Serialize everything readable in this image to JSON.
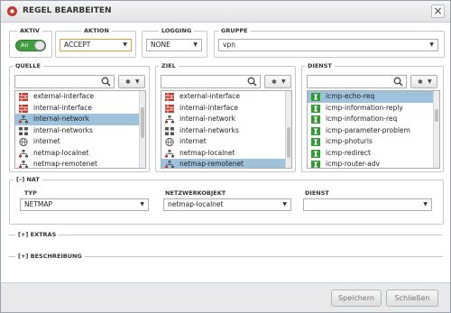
{
  "title": "REGEL BEARBEITEN",
  "close_glyph": "×",
  "aktiv": {
    "label": "AKTIV",
    "toggle_text": "An",
    "on": true
  },
  "aktion": {
    "label": "AKTION",
    "value": "ACCEPT"
  },
  "logging": {
    "label": "LOGGING",
    "value": "NONE"
  },
  "gruppe": {
    "label": "GRUPPE",
    "value": "vpn"
  },
  "quelle": {
    "label": "QUELLE",
    "search_value": "",
    "items": [
      {
        "label": "external-interface",
        "icon": "firewall-interface-icon",
        "selected": false
      },
      {
        "label": "internal-interface",
        "icon": "firewall-interface-icon",
        "selected": false
      },
      {
        "label": "internal-network",
        "icon": "network-icon",
        "selected": true
      },
      {
        "label": "internal-networks",
        "icon": "networks-icon",
        "selected": false
      },
      {
        "label": "internet",
        "icon": "globe-icon",
        "selected": false
      },
      {
        "label": "netmap-localnet",
        "icon": "network-icon",
        "selected": false
      },
      {
        "label": "netmap-remotenet",
        "icon": "network-icon",
        "selected": false
      }
    ]
  },
  "ziel": {
    "label": "ZIEL",
    "search_value": "",
    "items": [
      {
        "label": "external-interface",
        "icon": "firewall-interface-icon",
        "selected": false
      },
      {
        "label": "internal-interface",
        "icon": "firewall-interface-icon",
        "selected": false
      },
      {
        "label": "internal-network",
        "icon": "network-icon",
        "selected": false
      },
      {
        "label": "internal-networks",
        "icon": "networks-icon",
        "selected": false
      },
      {
        "label": "internet",
        "icon": "globe-icon",
        "selected": false
      },
      {
        "label": "netmap-localnet",
        "icon": "network-icon",
        "selected": false
      },
      {
        "label": "netmap-remotenet",
        "icon": "network-icon",
        "selected": true
      }
    ]
  },
  "dienst": {
    "label": "DIENST",
    "search_value": "",
    "items": [
      {
        "label": "icmp-echo-req",
        "icon": "service-icon",
        "selected": true
      },
      {
        "label": "icmp-information-reply",
        "icon": "service-icon",
        "selected": false
      },
      {
        "label": "icmp-information-req",
        "icon": "service-icon",
        "selected": false
      },
      {
        "label": "icmp-parameter-problem",
        "icon": "service-icon",
        "selected": false
      },
      {
        "label": "icmp-photuris",
        "icon": "service-icon",
        "selected": false
      },
      {
        "label": "icmp-redirect",
        "icon": "service-icon",
        "selected": false
      },
      {
        "label": "icmp-router-adv",
        "icon": "service-icon",
        "selected": false
      }
    ]
  },
  "nat": {
    "label": "[–] NAT",
    "typ_label": "TYP",
    "typ_value": "NETMAP",
    "netzwerkobjekt_label": "NETZWERKOBJEKT",
    "netzwerkobjekt_value": "netmap-localnet",
    "dienst_label": "DIENST",
    "dienst_value": ""
  },
  "extras": {
    "label": "[+] EXTRAS"
  },
  "beschreibung": {
    "label": "[+] BESCHREIBUNG"
  },
  "buttons": {
    "save": "Speichern",
    "close": "Schließen"
  },
  "colors": {
    "accent_select": "#9ec1dc",
    "toggle_on": "#3f9e3f",
    "service_green": "#2f9e2f"
  }
}
